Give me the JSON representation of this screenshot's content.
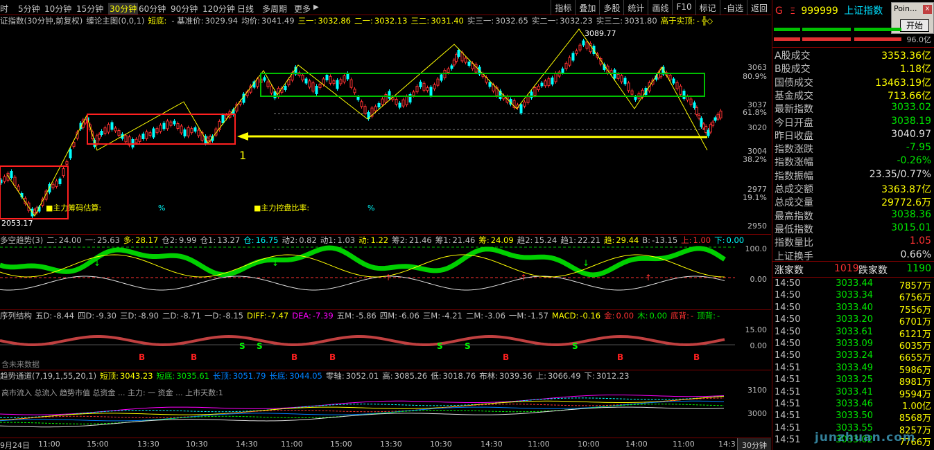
{
  "toolbar": {
    "periods": [
      "时",
      "5分钟",
      "10分钟",
      "15分钟",
      "30分钟",
      "60分钟",
      "90分钟",
      "120分钟",
      "日线",
      "多周期",
      "更多"
    ],
    "active_period": "30分钟",
    "right_buttons": [
      "指标",
      "叠加",
      "多股",
      "统计",
      "画线",
      "F10",
      "标记",
      "-自选",
      "返回"
    ]
  },
  "main_pane": {
    "title": "证指数(30分钟,前复权)",
    "indicator": "缠论主图(0,0,1)",
    "items": [
      {
        "label": "短底:",
        "value": "",
        "color": "#ffff00"
      },
      {
        "label": "- 基准价:",
        "value": "3029.94",
        "color": "#c0c0c0"
      },
      {
        "label": "均价:",
        "value": "3041.49",
        "color": "#c0c0c0"
      },
      {
        "label": "三一:",
        "value": "3032.86",
        "color": "#ffff00"
      },
      {
        "label": "二一:",
        "value": "3032.13",
        "color": "#ffff00"
      },
      {
        "label": "三二:",
        "value": "3031.40",
        "color": "#ffff00"
      },
      {
        "label": "实三一:",
        "value": "3032.65",
        "color": "#c0c0c0"
      },
      {
        "label": "实二一:",
        "value": "3032.23",
        "color": "#c0c0c0"
      },
      {
        "label": "实三二:",
        "value": "3031.80",
        "color": "#c0c0c0"
      },
      {
        "label": "高于实顶:",
        "value": "- ╬◇",
        "color": "#ffff00"
      }
    ],
    "y_labels": [
      "3063",
      "3037",
      "3020",
      "3004",
      "2977",
      "2950"
    ],
    "pct_labels": [
      "80.9%",
      "61.8%",
      "38.2%",
      "19.1%"
    ],
    "high_label": "3089.77",
    "low_label": "2053.17",
    "annotation_number": "1",
    "text_1": "主力筹码估算:",
    "text_1_unit": "%",
    "text_2": "主力控盘比率:",
    "text_2_unit": "%"
  },
  "pane2": {
    "title": "多空趋势(3)",
    "items": [
      {
        "label": "二:",
        "value": "24.00",
        "color": "#c0c0c0"
      },
      {
        "label": "一:",
        "value": "25.63",
        "color": "#c0c0c0"
      },
      {
        "label": "多:",
        "value": "28.17",
        "color": "#ffff00"
      },
      {
        "label": "仓2:",
        "value": "9.99",
        "color": "#c0c0c0"
      },
      {
        "label": "仓1:",
        "value": "13.27",
        "color": "#c0c0c0"
      },
      {
        "label": "仓:",
        "value": "16.75",
        "color": "#00ffff"
      },
      {
        "label": "动2:",
        "value": "0.82",
        "color": "#c0c0c0"
      },
      {
        "label": "动1:",
        "value": "1.03",
        "color": "#c0c0c0"
      },
      {
        "label": "动:",
        "value": "1.22",
        "color": "#ffff00"
      },
      {
        "label": "筹2:",
        "value": "21.46",
        "color": "#c0c0c0"
      },
      {
        "label": "筹1:",
        "value": "21.46",
        "color": "#c0c0c0"
      },
      {
        "label": "筹:",
        "value": "24.09",
        "color": "#ffff00"
      },
      {
        "label": "趋2:",
        "value": "15.24",
        "color": "#c0c0c0"
      },
      {
        "label": "趋1:",
        "value": "22.21",
        "color": "#c0c0c0"
      },
      {
        "label": "趋:",
        "value": "29.44",
        "color": "#ffff00"
      },
      {
        "label": "B:",
        "value": "-13.15",
        "color": "#c0c0c0"
      },
      {
        "label": "上:",
        "value": "1.00",
        "color": "#ff3232"
      },
      {
        "label": "下:",
        "value": "0.00",
        "color": "#00ffff"
      }
    ],
    "y_labels": [
      "100.0",
      "0.00"
    ]
  },
  "pane3": {
    "title": "序列结构",
    "items": [
      {
        "label": "五D:",
        "value": "-8.44",
        "color": "#c0c0c0"
      },
      {
        "label": "四D:",
        "value": "-9.30",
        "color": "#c0c0c0"
      },
      {
        "label": "三D:",
        "value": "-8.90",
        "color": "#c0c0c0"
      },
      {
        "label": "二D:",
        "value": "-8.71",
        "color": "#c0c0c0"
      },
      {
        "label": "一D:",
        "value": "-8.15",
        "color": "#c0c0c0"
      },
      {
        "label": "DIFF:",
        "value": "-7.47",
        "color": "#ffff00"
      },
      {
        "label": "DEA:",
        "value": "-7.39",
        "color": "#ff00ff"
      },
      {
        "label": "五M:",
        "value": "-5.86",
        "color": "#c0c0c0"
      },
      {
        "label": "四M:",
        "value": "-6.06",
        "color": "#c0c0c0"
      },
      {
        "label": "三M:",
        "value": "-4.21",
        "color": "#c0c0c0"
      },
      {
        "label": "二M:",
        "value": "-3.06",
        "color": "#c0c0c0"
      },
      {
        "label": "一M:",
        "value": "-1.57",
        "color": "#c0c0c0"
      },
      {
        "label": "MACD:",
        "value": "-0.16",
        "color": "#ffff00"
      },
      {
        "label": "金:",
        "value": "0.00",
        "color": "#ff3232"
      },
      {
        "label": "木:",
        "value": "0.00",
        "color": "#00e600"
      },
      {
        "label": "底背:",
        "value": "-",
        "color": "#ff3232"
      },
      {
        "label": "顶背:",
        "value": "-",
        "color": "#00e600"
      }
    ],
    "y_labels": [
      "15.00",
      "0.00"
    ],
    "future_text": "含未来数据"
  },
  "pane4": {
    "title": "趋势通道(7,19,1,55,20,1)",
    "items": [
      {
        "label": "短顶:",
        "value": "3043.23",
        "color": "#ffff00"
      },
      {
        "label": "短底:",
        "value": "3035.61",
        "color": "#00e600"
      },
      {
        "label": "长顶:",
        "value": "3051.79",
        "color": "#0080ff"
      },
      {
        "label": "长底:",
        "value": "3044.05",
        "color": "#0080ff"
      },
      {
        "label": "零轴:",
        "value": "3052.01",
        "color": "#c0c0c0"
      },
      {
        "label": "高:",
        "value": "3085.26",
        "color": "#c0c0c0"
      },
      {
        "label": "低:",
        "value": "3018.76",
        "color": "#c0c0c0"
      },
      {
        "label": "布林:",
        "value": "3039.36",
        "color": "#c0c0c0"
      },
      {
        "label": "上:",
        "value": "3066.49",
        "color": "#c0c0c0"
      },
      {
        "label": "下:",
        "value": "3012.23",
        "color": "#c0c0c0"
      }
    ],
    "overlay_text": "高市流入 总流入 趋势市值 总资金 ... 主力: 一 资金 ... 上市天数:1",
    "y_labels": [
      "3100",
      "3000"
    ]
  },
  "time_axis": {
    "labels": [
      "9月24日",
      "11:00",
      "15:00",
      "13:30",
      "10:30",
      "14:30",
      "11:00",
      "15:00",
      "13:30",
      "10:30",
      "14:30",
      "11:00",
      "10:00",
      "14:00",
      "11:00",
      "14:3"
    ],
    "period_tag": "30分钟"
  },
  "right_panel": {
    "marker": "G",
    "code_prefix": "Ξ",
    "code": "999999",
    "name": "上证指数",
    "popup_title": "Poin...",
    "popup_close": "x",
    "popup_button": "开始",
    "ratio_label": "96.0亿",
    "stats": [
      {
        "k": "A股成交",
        "v": "3353.36亿",
        "c": "yellow"
      },
      {
        "k": "B股成交",
        "v": "1.18亿",
        "c": "yellow"
      },
      {
        "k": "国债成交",
        "v": "13463.19亿",
        "c": "yellow"
      },
      {
        "k": "基金成交",
        "v": "713.66亿",
        "c": "yellow"
      },
      {
        "k": "最新指数",
        "v": "3033.02",
        "c": "green"
      },
      {
        "k": "今日开盘",
        "v": "3038.19",
        "c": "green"
      },
      {
        "k": "昨日收盘",
        "v": "3040.97",
        "c": "white"
      },
      {
        "k": "指数涨跌",
        "v": "-7.95",
        "c": "green"
      },
      {
        "k": "指数涨幅",
        "v": "-0.26%",
        "c": "green"
      },
      {
        "k": "指数振幅",
        "v": "23.35/0.77%",
        "c": "white"
      },
      {
        "k": "总成交额",
        "v": "3363.87亿",
        "c": "yellow"
      },
      {
        "k": "总成交量",
        "v": "29772.6万",
        "c": "yellow"
      },
      {
        "k": "最高指数",
        "v": "3038.36",
        "c": "green"
      },
      {
        "k": "最低指数",
        "v": "3015.01",
        "c": "green"
      },
      {
        "k": "指数量比",
        "v": "1.05",
        "c": "red"
      },
      {
        "k": "上证换手",
        "v": "0.66%",
        "c": "white"
      }
    ],
    "up_label": "涨家数",
    "up_count": "1019",
    "down_label": "跌家数",
    "down_count": "1190",
    "ticks": [
      {
        "t": "14:50",
        "p": "3033.44",
        "v": "7857万"
      },
      {
        "t": "14:50",
        "p": "3033.34",
        "v": "6756万"
      },
      {
        "t": "14:50",
        "p": "3033.40",
        "v": "7556万"
      },
      {
        "t": "14:50",
        "p": "3033.20",
        "v": "6701万"
      },
      {
        "t": "14:50",
        "p": "3033.61",
        "v": "6121万"
      },
      {
        "t": "14:50",
        "p": "3033.09",
        "v": "6035万"
      },
      {
        "t": "14:50",
        "p": "3033.24",
        "v": "6655万"
      },
      {
        "t": "14:51",
        "p": "3033.49",
        "v": "5986万"
      },
      {
        "t": "14:51",
        "p": "3033.25",
        "v": "8981万"
      },
      {
        "t": "14:51",
        "p": "3033.41",
        "v": "9594万"
      },
      {
        "t": "14:51",
        "p": "3033.46",
        "v": "1.00亿"
      },
      {
        "t": "14:51",
        "p": "3033.50",
        "v": "8568万"
      },
      {
        "t": "14:51",
        "p": "3033.55",
        "v": "8257万"
      },
      {
        "t": "14:51",
        "p": "3033.02",
        "v": "7766万"
      }
    ],
    "watermark": "junzhuan.com"
  },
  "colors": {
    "up": "#ff3232",
    "down": "#00ffff",
    "frame": "#800000",
    "accent": "#ffff00"
  }
}
